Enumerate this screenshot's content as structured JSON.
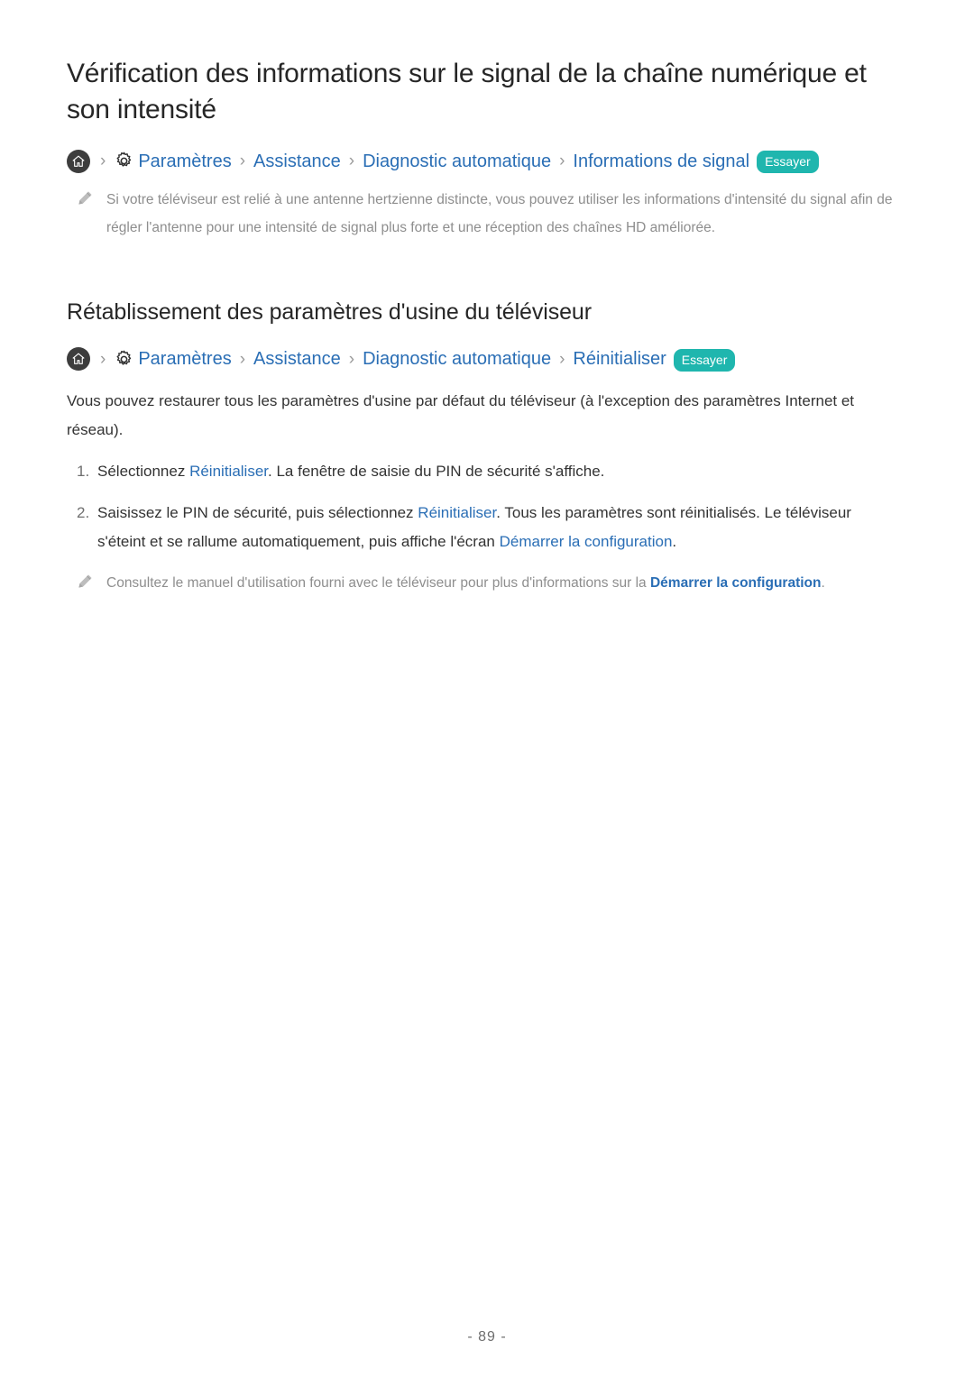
{
  "document": {
    "page_number": "- 89 -"
  },
  "sections": [
    {
      "id": "signal-info",
      "title": "Vérification des informations sur le signal de la chaîne numérique et son intensité",
      "breadcrumb": {
        "home_icon": "home-icon",
        "gear_icon": "gear-icon",
        "separator": "›",
        "items": [
          "Paramètres",
          "Assistance",
          "Diagnostic automatique",
          "Informations de signal"
        ],
        "badge": "Essayer"
      },
      "notes": [
        {
          "icon": "pencil-icon",
          "segments": [
            {
              "text": "Si votre téléviseur est relié à une antenne hertzienne distincte, vous pouvez utiliser les informations d'intensité du signal afin de régler l'antenne pour une intensité de signal plus forte et une réception des chaînes HD améliorée.",
              "link": false
            }
          ]
        }
      ]
    },
    {
      "id": "factory-reset",
      "title": "Rétablissement des paramètres d'usine du téléviseur",
      "breadcrumb": {
        "home_icon": "home-icon",
        "gear_icon": "gear-icon",
        "separator": "›",
        "items": [
          "Paramètres",
          "Assistance",
          "Diagnostic automatique",
          "Réinitialiser"
        ],
        "badge": "Essayer"
      },
      "paragraph": "Vous pouvez restaurer tous les paramètres d'usine par défaut du téléviseur (à l'exception des paramètres Internet et réseau).",
      "steps": [
        {
          "number": "1.",
          "segments": [
            {
              "text": "Sélectionnez ",
              "link": false
            },
            {
              "text": "Réinitialiser",
              "link": true
            },
            {
              "text": ". La fenêtre de saisie du PIN de sécurité s'affiche.",
              "link": false
            }
          ]
        },
        {
          "number": "2.",
          "segments": [
            {
              "text": "Saisissez le PIN de sécurité, puis sélectionnez ",
              "link": false
            },
            {
              "text": "Réinitialiser",
              "link": true
            },
            {
              "text": ". Tous les paramètres sont réinitialisés. Le téléviseur s'éteint et se rallume automatiquement, puis affiche l'écran ",
              "link": false
            },
            {
              "text": "Démarrer la configuration",
              "link": true
            },
            {
              "text": ".",
              "link": false
            }
          ]
        }
      ],
      "notes": [
        {
          "icon": "pencil-icon",
          "segments": [
            {
              "text": "Consultez le manuel d'utilisation fourni avec le téléviseur pour plus d'informations sur la ",
              "link": false
            },
            {
              "text": "Démarrer la configuration",
              "link": true
            },
            {
              "text": ".",
              "link": false
            }
          ]
        }
      ]
    }
  ],
  "colors": {
    "link": "#2a6eb5",
    "badge_bg": "#1fb6ae",
    "badge_text": "#ffffff",
    "note_text": "#8e8e8e",
    "heading": "#262626",
    "body_text": "#333333",
    "home_icon_bg": "#3d3d3d"
  }
}
